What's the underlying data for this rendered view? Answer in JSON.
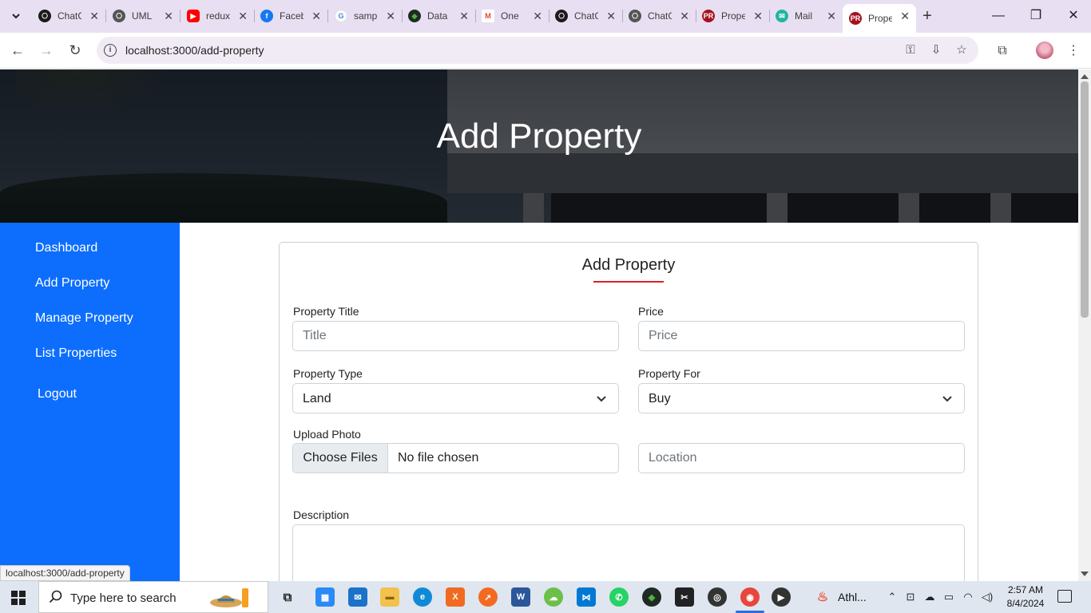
{
  "browser": {
    "tabs": [
      {
        "title": "ChatGPT",
        "icon": "openai-icon",
        "color": "#1a1a1a"
      },
      {
        "title": "UML",
        "icon": "openai-icon",
        "color": "#555555"
      },
      {
        "title": "redux",
        "icon": "youtube-icon",
        "color": "#ff0000"
      },
      {
        "title": "Facebook",
        "icon": "facebook-icon",
        "color": "#1877f2"
      },
      {
        "title": "sample",
        "icon": "google-icon",
        "color": "#4285f4"
      },
      {
        "title": "Data",
        "icon": "mongodb-icon",
        "color": "#1f2a24"
      },
      {
        "title": "One",
        "icon": "gmail-icon",
        "color": "#ea4335"
      },
      {
        "title": "ChatGPT",
        "icon": "openai-icon",
        "color": "#1a1a1a"
      },
      {
        "title": "ChatGPT",
        "icon": "openai-icon",
        "color": "#555555"
      },
      {
        "title": "Property",
        "icon": "pr-icon",
        "color": "#a3121e"
      },
      {
        "title": "Mail",
        "icon": "mailtrap-icon",
        "color": "#22b5a0"
      },
      {
        "title": "Property",
        "icon": "pr-icon",
        "color": "#a3121e"
      }
    ],
    "url": "localhost:3000/add-property",
    "status_url": "localhost:3000/add-property"
  },
  "page": {
    "hero_title": "Add Property",
    "sidebar": [
      {
        "label": "Dashboard"
      },
      {
        "label": "Add Property"
      },
      {
        "label": "Manage Property"
      },
      {
        "label": "List Properties"
      },
      {
        "label": "Logout"
      }
    ],
    "form": {
      "title": "Add Property",
      "title_property": {
        "label": "Property Title",
        "placeholder": "Title",
        "value": ""
      },
      "price": {
        "label": "Price",
        "placeholder": "Price",
        "value": ""
      },
      "property_type": {
        "label": "Property Type",
        "selected": "Land"
      },
      "property_for": {
        "label": "Property For",
        "selected": "Buy"
      },
      "upload_photo": {
        "label": "Upload Photo",
        "button": "Choose Files",
        "status": "No file chosen"
      },
      "location": {
        "placeholder": "Location",
        "value": ""
      },
      "description": {
        "label": "Description",
        "value": ""
      }
    },
    "accent_colors": {
      "sidebar": "#0d6efd",
      "title_underline": "#dd2222"
    }
  },
  "taskbar": {
    "search_placeholder": "Type here to search",
    "weather_label": "Athl...",
    "time": "2:57 AM",
    "date": "8/4/2024"
  }
}
